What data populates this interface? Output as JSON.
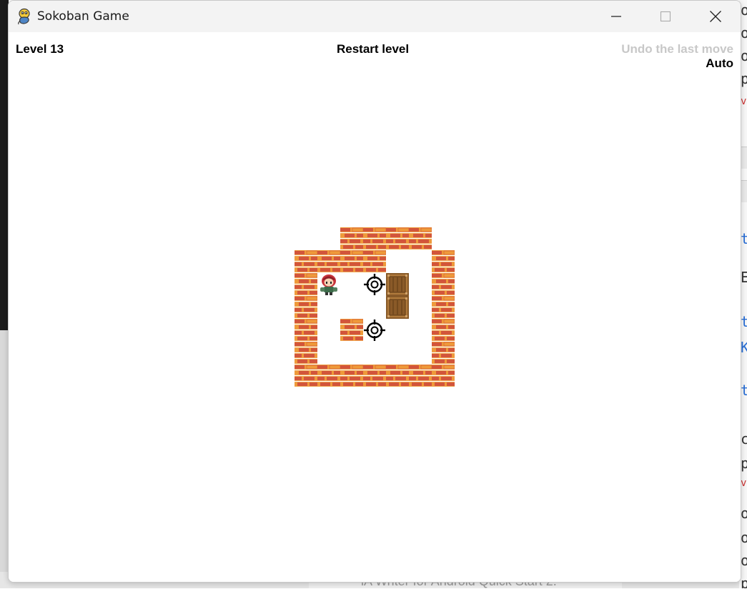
{
  "window": {
    "title": "Sokoban Game",
    "icon": "python-snake-icon"
  },
  "controls": {
    "minimize_icon": "minimize-icon",
    "maximize_icon": "maximize-icon",
    "close_icon": "close-icon"
  },
  "hud": {
    "level_label": "Level 13",
    "restart_label": "Restart level",
    "undo_label": "Undo the last move",
    "auto_label": "Auto"
  },
  "board": {
    "legend": {
      "#": "wall",
      " ": "floor",
      ".": "target",
      "$": "box",
      "@": "player",
      "-": "outside"
    },
    "rows": [
      "--####-",
      "####--#",
      "#@-.$-#",
      "#---$-#",
      "#-#.--#",
      "#-----#",
      "#######"
    ]
  },
  "colors": {
    "brick_orange": "#ee9a3a",
    "brick_red": "#d2553b",
    "undo_disabled": "#c8c8c8",
    "box_wood": "#b07a3c"
  },
  "background": {
    "bottom_text": "iA Writer for Android Quick Start 2."
  }
}
